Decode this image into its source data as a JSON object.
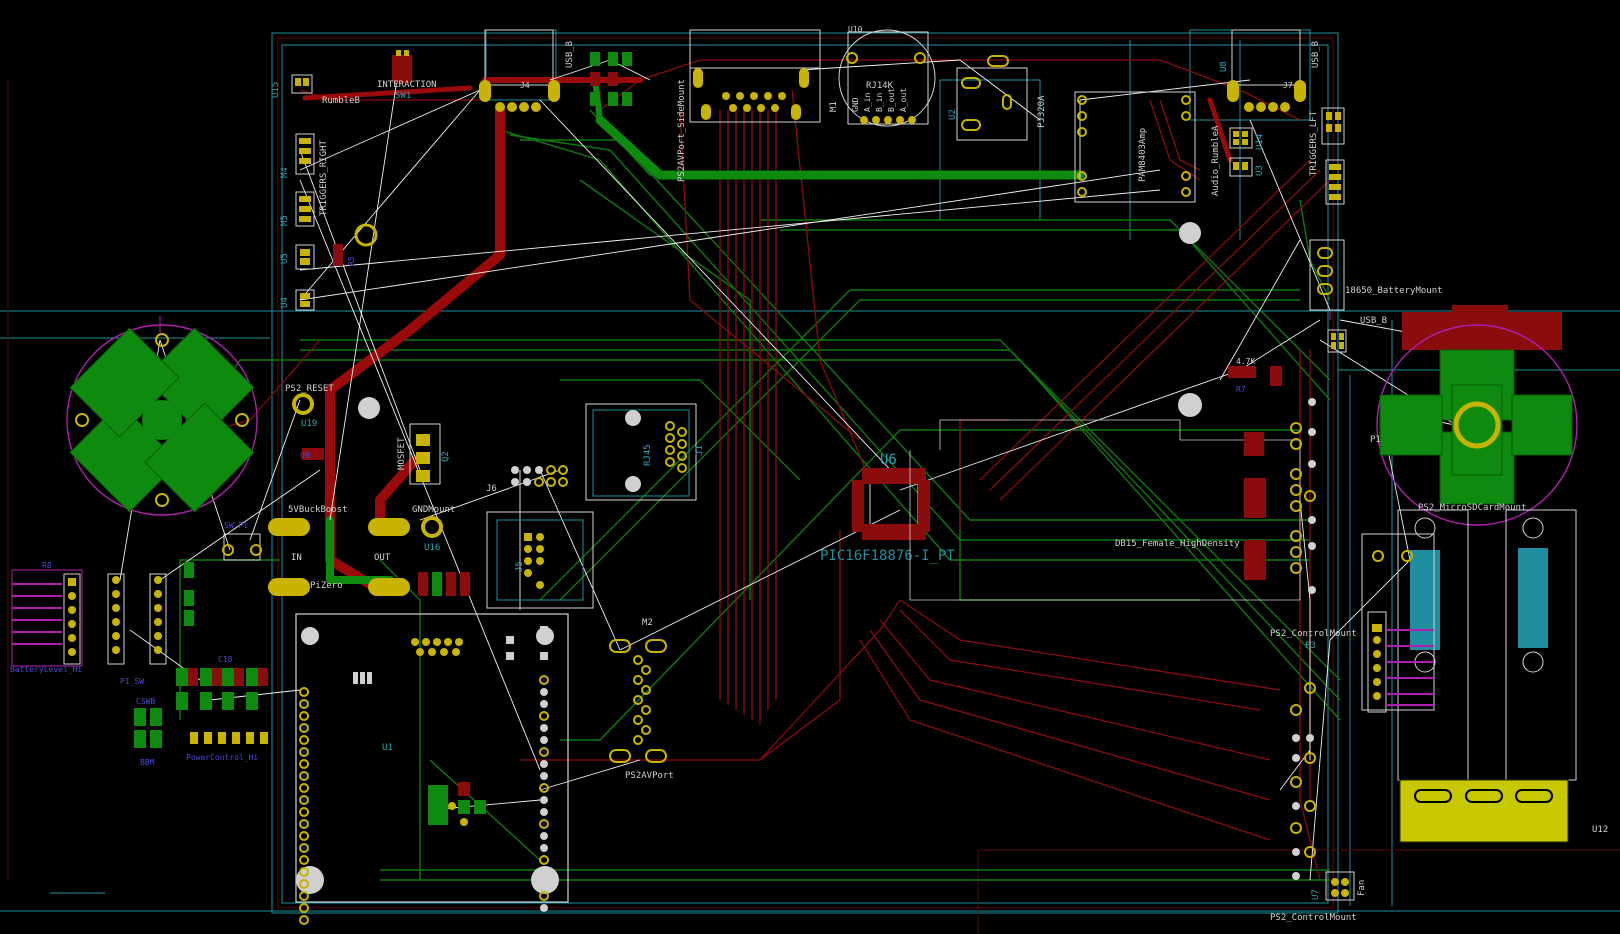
{
  "colors": {
    "background": "#000000",
    "front_copper": "#8a0c0c",
    "back_copper": "#0e7a0e",
    "silkscreen": "#d2d2d2",
    "fab_cyan": "#1f8f9f",
    "pad_yellow": "#c8b400",
    "ratsnest": "#ffffff",
    "courtyard_magenta": "#b020b0"
  },
  "labels": {
    "interaction": "INTERACTION",
    "sw1": "SW1",
    "j4": "J4",
    "usb_b_top": "USB_B",
    "usb_b_right": "USB_B",
    "usb_b_mid": "USB_B",
    "u10": "U10",
    "rj14k": "RJ14K",
    "m1": "M1",
    "rumble_b": "RumbleB",
    "u15": "U15",
    "ps2av_side": "PS2AVPort_SideMount",
    "pj3": "PJ320A",
    "u2": "U2",
    "pam": "PAM8403Amp",
    "audio_rumble": "Audio_RumbleA",
    "j7": "J7",
    "u8": "U8",
    "triggers_left": "TRIGGERS_LFT",
    "u14": "U14",
    "u3": "U3",
    "m4": "M4",
    "m5": "M5",
    "triggers_right": "TRIGGERS_RIGHT",
    "u5": "U5",
    "u4": "U4",
    "r5": "R5",
    "battery_mount": "18650_BatteryMount",
    "ps2_reset": "PS2_RESET",
    "u19": "U19",
    "q2": "Q2",
    "mosfet": "MOSFET",
    "ic_u6": "U6",
    "ic_part": "PIC16F18876-I_PT",
    "r7": "R7",
    "r7_val": "4.7K",
    "rj45": "RJ45",
    "j1": "J1",
    "j6": "J6",
    "j5": "J5",
    "buck": "5VBuckBoost",
    "gnd_mount": "GNDMount",
    "u16": "U16",
    "in": "IN",
    "out": "OUT",
    "pizero": "PiZero",
    "db15": "DB15_Female_HighDensity",
    "micro_sd": "PS2_MicroSDCardMount",
    "p1": "P1",
    "m2": "M2",
    "ps2av": "PS2AVPort",
    "ps2_control_1": "PS2_ControlMount",
    "p3": "P3",
    "ps2_control_2": "PS2_ControlMount",
    "u1": "U1",
    "u12": "U12",
    "fan": "Fan",
    "u7": "U7",
    "pi_sw": "PI_SW",
    "power_ctrl": "PowerControl_Hi",
    "batt_lvl": "BatteryLevel_Hi",
    "r8": "R8",
    "u9": "U9",
    "bbm": "BBM",
    "c18": "C18",
    "cswb": "CSWB",
    "sw_label": "SW_Pi"
  }
}
